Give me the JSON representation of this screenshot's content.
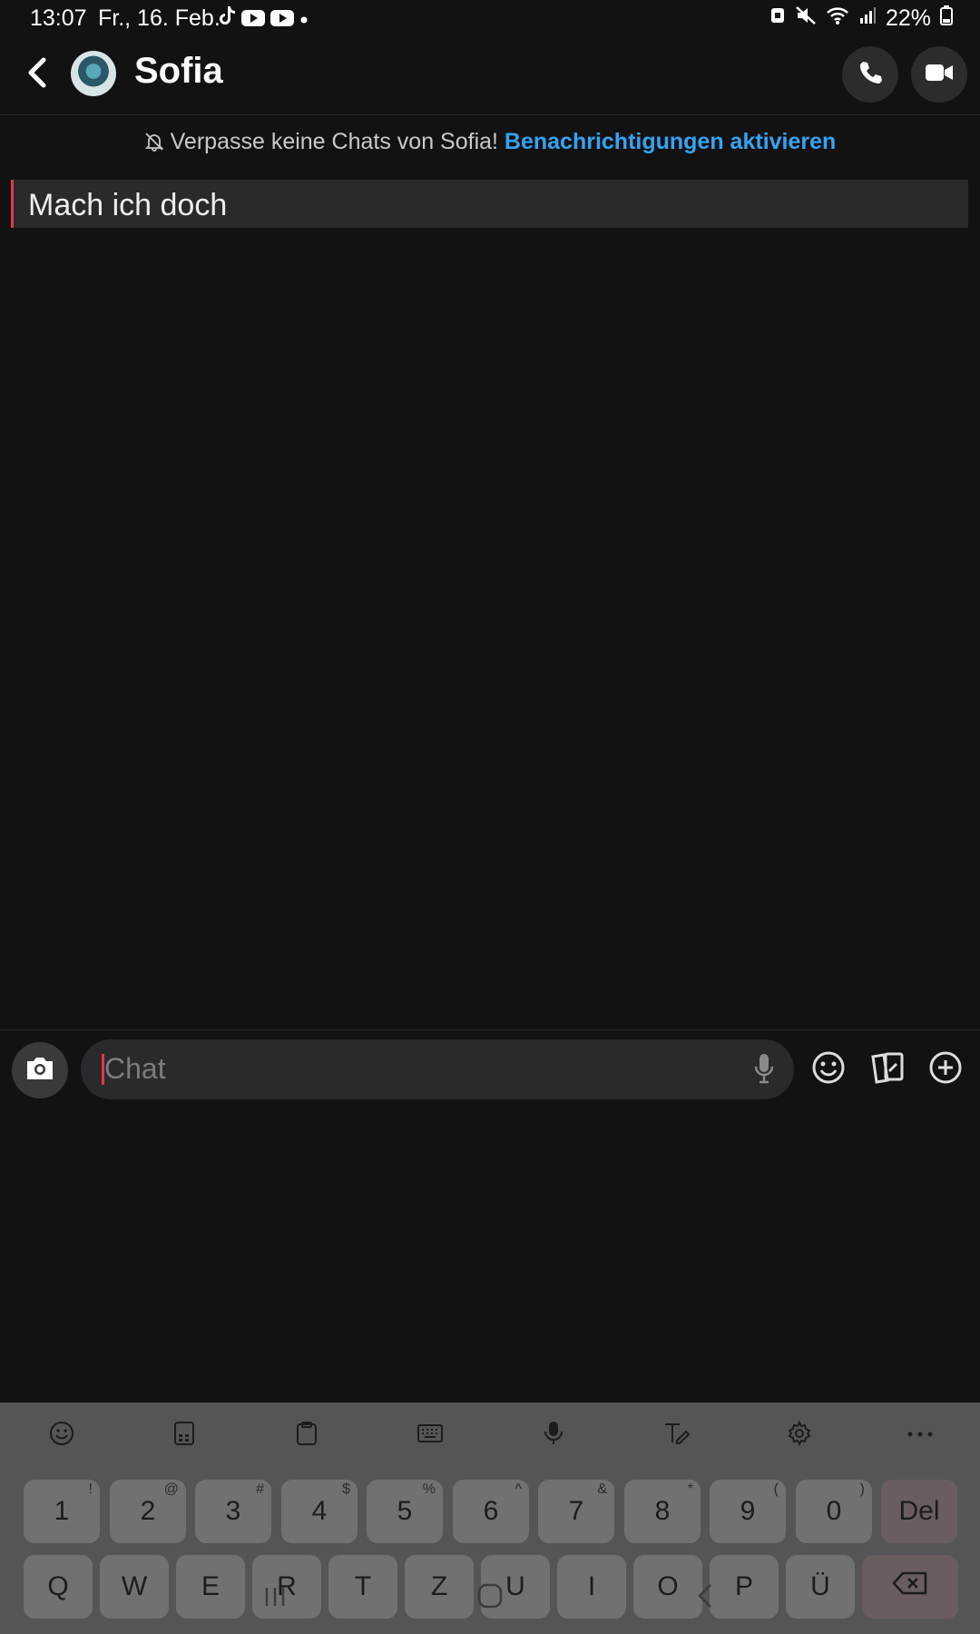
{
  "status_bar": {
    "time": "13:07",
    "date": "Fr., 16. Feb.",
    "battery": "22%",
    "app_icons": [
      "tiktok-icon",
      "youtube-icon",
      "youtube-icon",
      "dot-icon"
    ],
    "right_icons": [
      "alarm-icon",
      "mute-icon",
      "wifi-icon",
      "signal-icon",
      "battery-icon"
    ]
  },
  "header": {
    "contact_name": "Sofia",
    "back_icon": "chevron-left-icon",
    "call_icon": "phone-icon",
    "video_icon": "video-icon"
  },
  "notification_prompt": {
    "text": "Verpasse keine Chats von Sofia!",
    "link": "Benachrichtigungen aktivieren",
    "icon": "bell-off-icon"
  },
  "messages": [
    {
      "text": "Mach ich doch",
      "accent_color": "#e2394d"
    }
  ],
  "composer": {
    "placeholder": "Chat",
    "icons": [
      "camera-icon",
      "mic-icon",
      "emoji-icon",
      "cards-icon",
      "plus-icon"
    ]
  },
  "keyboard": {
    "toolbar": [
      "emoji-icon",
      "sticker-icon",
      "clipboard-icon",
      "keyboard-icon",
      "mic-icon",
      "handwriting-icon",
      "settings-icon",
      "more-icon"
    ],
    "number_row": [
      {
        "key": "1",
        "sup": "!"
      },
      {
        "key": "2",
        "sup": "@"
      },
      {
        "key": "3",
        "sup": "#"
      },
      {
        "key": "4",
        "sup": "$"
      },
      {
        "key": "5",
        "sup": "%"
      },
      {
        "key": "6",
        "sup": "^"
      },
      {
        "key": "7",
        "sup": "&"
      },
      {
        "key": "8",
        "sup": "*"
      },
      {
        "key": "9",
        "sup": "("
      },
      {
        "key": "0",
        "sup": ")"
      }
    ],
    "del_label": "Del",
    "letter_row": [
      "Q",
      "W",
      "E",
      "R",
      "T",
      "Z",
      "U",
      "I",
      "O",
      "P",
      "Ü"
    ]
  },
  "colors": {
    "background": "#121213",
    "link": "#36a3f2",
    "accent": "#e2394d"
  }
}
